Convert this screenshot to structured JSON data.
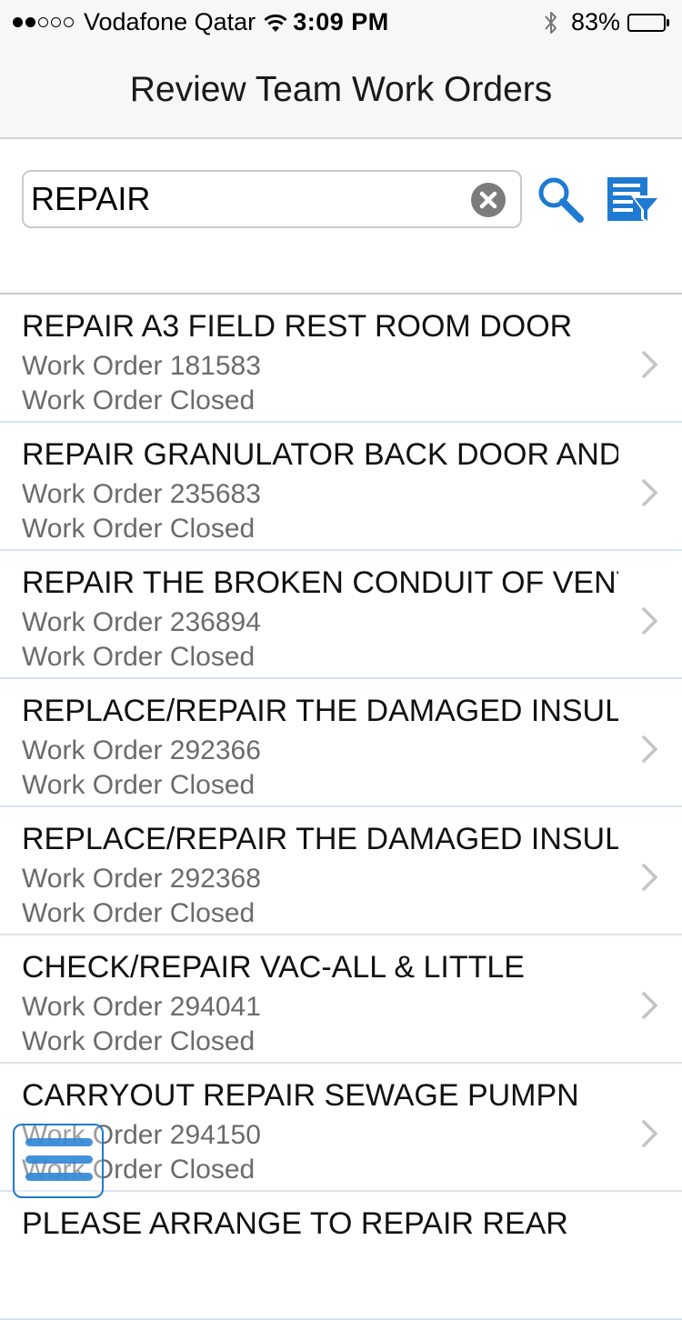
{
  "status_bar": {
    "signal_dots_filled": 2,
    "signal_dots_total": 5,
    "carrier": "Vodafone Qatar",
    "wifi_icon": "wifi-icon",
    "time": "3:09 PM",
    "bluetooth_icon": "bluetooth-icon",
    "battery_percent": "83%",
    "battery_level": 0.83
  },
  "nav": {
    "title": "Review Team Work Orders"
  },
  "search": {
    "value": "REPAIR",
    "clear_icon": "clear-circle-icon",
    "search_icon": "search-icon",
    "filter_icon": "filter-list-icon"
  },
  "work_orders": [
    {
      "title": "REPAIR A3 FIELD REST ROOM DOOR",
      "number": "Work Order 181583",
      "status": "Work Order Closed"
    },
    {
      "title": "REPAIR GRANULATOR BACK DOOR AND",
      "number": "Work Order 235683",
      "status": "Work Order Closed"
    },
    {
      "title": "REPAIR THE BROKEN CONDUIT OF VENT",
      "number": "Work Order 236894",
      "status": "Work Order Closed"
    },
    {
      "title": "REPLACE/REPAIR THE DAMAGED INSULATION",
      "number": "Work Order 292366",
      "status": "Work Order Closed"
    },
    {
      "title": "REPLACE/REPAIR THE DAMAGED INSULATION",
      "number": "Work Order 292368",
      "status": "Work Order Closed"
    },
    {
      "title": "CHECK/REPAIR VAC-ALL & LITTLE",
      "number": "Work Order 294041",
      "status": "Work Order Closed"
    },
    {
      "title": "CARRYOUT REPAIR SEWAGE PUMPN",
      "number": "Work Order 294150",
      "status": "Work Order Closed"
    },
    {
      "title": "PLEASE ARRANGE TO REPAIR REAR",
      "number": "",
      "status": ""
    }
  ],
  "chevron_icon": "chevron-right-icon",
  "menu_icon": "hamburger-menu-icon",
  "colors": {
    "accent": "#1f7ad1",
    "bar_background": "#f7f7f7",
    "secondary_text": "#6b6b6b",
    "row_divider": "#d6e3f0"
  }
}
